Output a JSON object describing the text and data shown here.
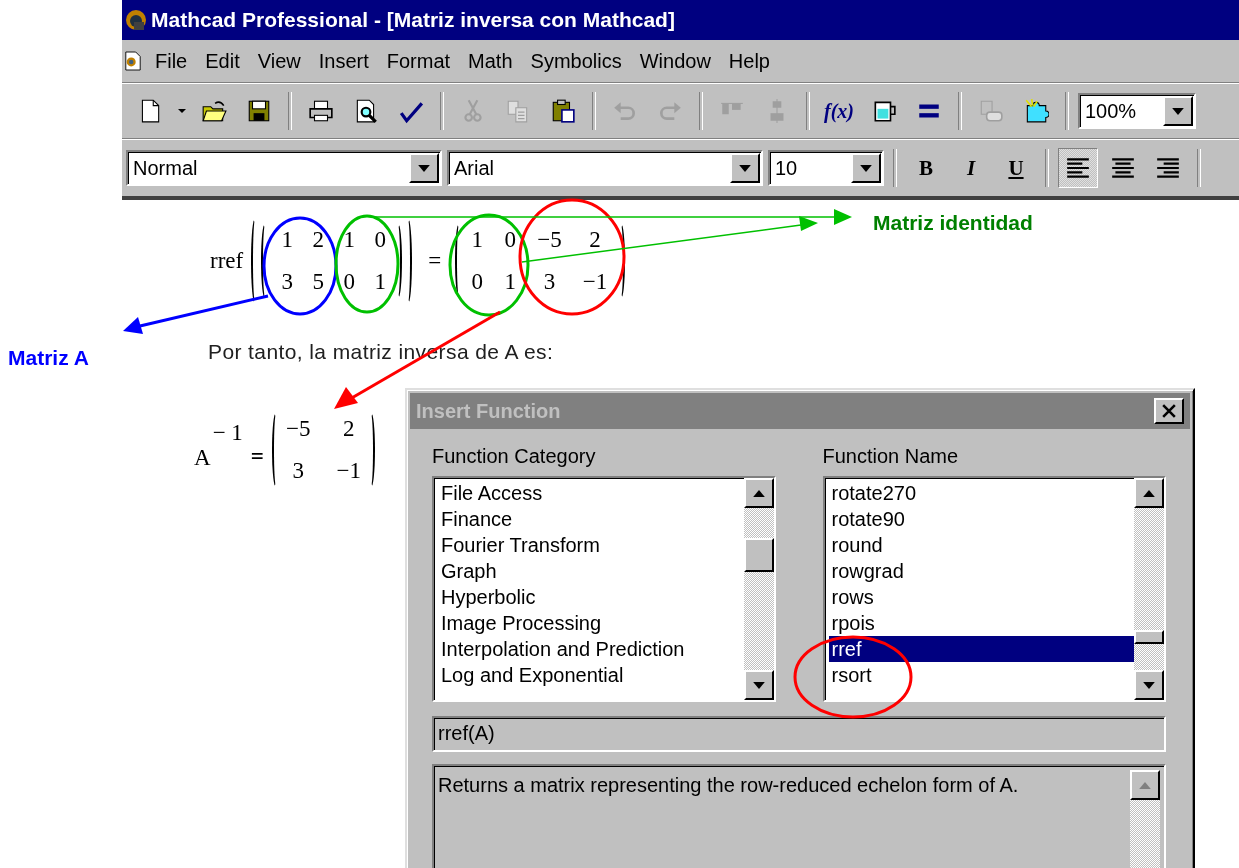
{
  "window": {
    "title": "Mathcad Professional - [Matriz inversa con Mathcad]"
  },
  "menu": [
    "File",
    "Edit",
    "View",
    "Insert",
    "Format",
    "Math",
    "Symbolics",
    "Window",
    "Help"
  ],
  "toolbar": [
    {
      "kind": "new",
      "disabled": false
    },
    {
      "kind": "caret",
      "disabled": false
    },
    {
      "kind": "open",
      "disabled": false
    },
    {
      "kind": "save",
      "disabled": false
    },
    {
      "kind": "separator"
    },
    {
      "kind": "print",
      "disabled": false
    },
    {
      "kind": "preview",
      "disabled": false
    },
    {
      "kind": "spell",
      "disabled": false
    },
    {
      "kind": "separator"
    },
    {
      "kind": "cut",
      "disabled": true
    },
    {
      "kind": "copy",
      "disabled": true
    },
    {
      "kind": "paste",
      "disabled": false
    },
    {
      "kind": "separator"
    },
    {
      "kind": "undo",
      "disabled": true
    },
    {
      "kind": "redo",
      "disabled": true
    },
    {
      "kind": "separator"
    },
    {
      "kind": "align-across",
      "disabled": true
    },
    {
      "kind": "align-down",
      "disabled": true
    },
    {
      "kind": "separator"
    },
    {
      "kind": "function",
      "label": "f(x)",
      "disabled": false
    },
    {
      "kind": "resource",
      "disabled": false
    },
    {
      "kind": "calculate",
      "disabled": false
    },
    {
      "kind": "separator"
    },
    {
      "kind": "component",
      "disabled": true
    },
    {
      "kind": "wizard",
      "disabled": false
    },
    {
      "kind": "separator"
    },
    {
      "kind": "zoom",
      "value": "100%"
    }
  ],
  "format_bar": {
    "style": "Normal",
    "font": "Arial",
    "size": "10",
    "buttons": [
      {
        "kind": "bold",
        "label": "B",
        "selected": false
      },
      {
        "kind": "italic",
        "label": "I",
        "selected": false
      },
      {
        "kind": "underline",
        "label": "U",
        "selected": false
      }
    ],
    "align": [
      {
        "kind": "left",
        "selected": true
      },
      {
        "kind": "center",
        "selected": false
      },
      {
        "kind": "right",
        "selected": false
      }
    ]
  },
  "worksheet": {
    "equation": {
      "function": "rref",
      "argument": [
        [
          "1",
          "2",
          "1",
          "0"
        ],
        [
          "3",
          "5",
          "0",
          "1"
        ]
      ],
      "equals": "=",
      "result": [
        [
          "1",
          "0",
          "−5",
          "2"
        ],
        [
          "0",
          "1",
          "3",
          "−1"
        ]
      ]
    },
    "text": "Por tanto, la matriz inversa de A es:",
    "inverse": {
      "name": "A",
      "exponent": "− 1",
      "equals": "=",
      "matrix": [
        [
          "−5",
          "2"
        ],
        [
          "3",
          "−1"
        ]
      ]
    }
  },
  "annotations": [
    {
      "text": "Matriz identidad",
      "color": "#008000"
    },
    {
      "text": "Matriz A",
      "color": "#0000ff"
    }
  ],
  "dialog": {
    "title": "Insert Function",
    "category_label": "Function Category",
    "categories": [
      {
        "label": "File Access",
        "selected": false
      },
      {
        "label": "Finance",
        "selected": false
      },
      {
        "label": "Fourier Transform",
        "selected": false
      },
      {
        "label": "Graph",
        "selected": false
      },
      {
        "label": "Hyperbolic",
        "selected": false
      },
      {
        "label": "Image Processing",
        "selected": false
      },
      {
        "label": "Interpolation and Prediction",
        "selected": false
      },
      {
        "label": "Log and Exponential",
        "selected": false
      }
    ],
    "name_label": "Function Name",
    "names": [
      {
        "label": "rotate270",
        "selected": false
      },
      {
        "label": "rotate90",
        "selected": false
      },
      {
        "label": "round",
        "selected": false
      },
      {
        "label": "rowgrad",
        "selected": false
      },
      {
        "label": "rows",
        "selected": false
      },
      {
        "label": "rpois",
        "selected": false
      },
      {
        "label": "rref",
        "selected": true
      },
      {
        "label": "rsort",
        "selected": false
      }
    ],
    "signature": "rref(A)",
    "description": "Returns a matrix representing the row-reduced echelon form of A."
  }
}
